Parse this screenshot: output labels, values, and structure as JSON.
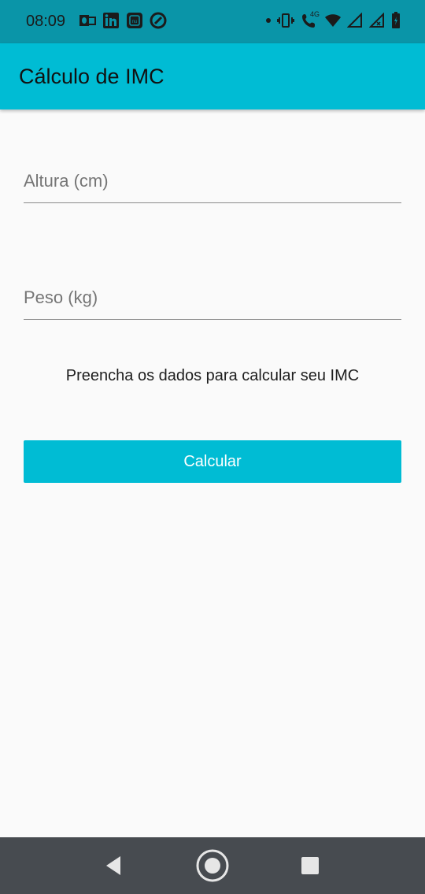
{
  "status_bar": {
    "time": "08:09",
    "left_icons": [
      "outlook-icon",
      "linkedin-icon",
      "nubank-icon",
      "app-icon"
    ],
    "right_icons": [
      "dot-icon",
      "vibrate-icon",
      "volte-call-icon",
      "wifi-icon",
      "signal-icon",
      "signal-no-data-icon",
      "battery-icon"
    ],
    "network_label": "4G"
  },
  "app_bar": {
    "title": "Cálculo de IMC",
    "color": "#00bcd4"
  },
  "form": {
    "altura": {
      "placeholder": "Altura (cm)",
      "value": ""
    },
    "peso": {
      "placeholder": "Peso (kg)",
      "value": ""
    }
  },
  "info_text": "Preencha os dados para calcular seu IMC",
  "calculate_button": {
    "label": "Calcular",
    "color": "#00bcd4"
  },
  "nav_bar": {
    "buttons": [
      "back-icon",
      "home-icon",
      "recents-icon"
    ]
  }
}
